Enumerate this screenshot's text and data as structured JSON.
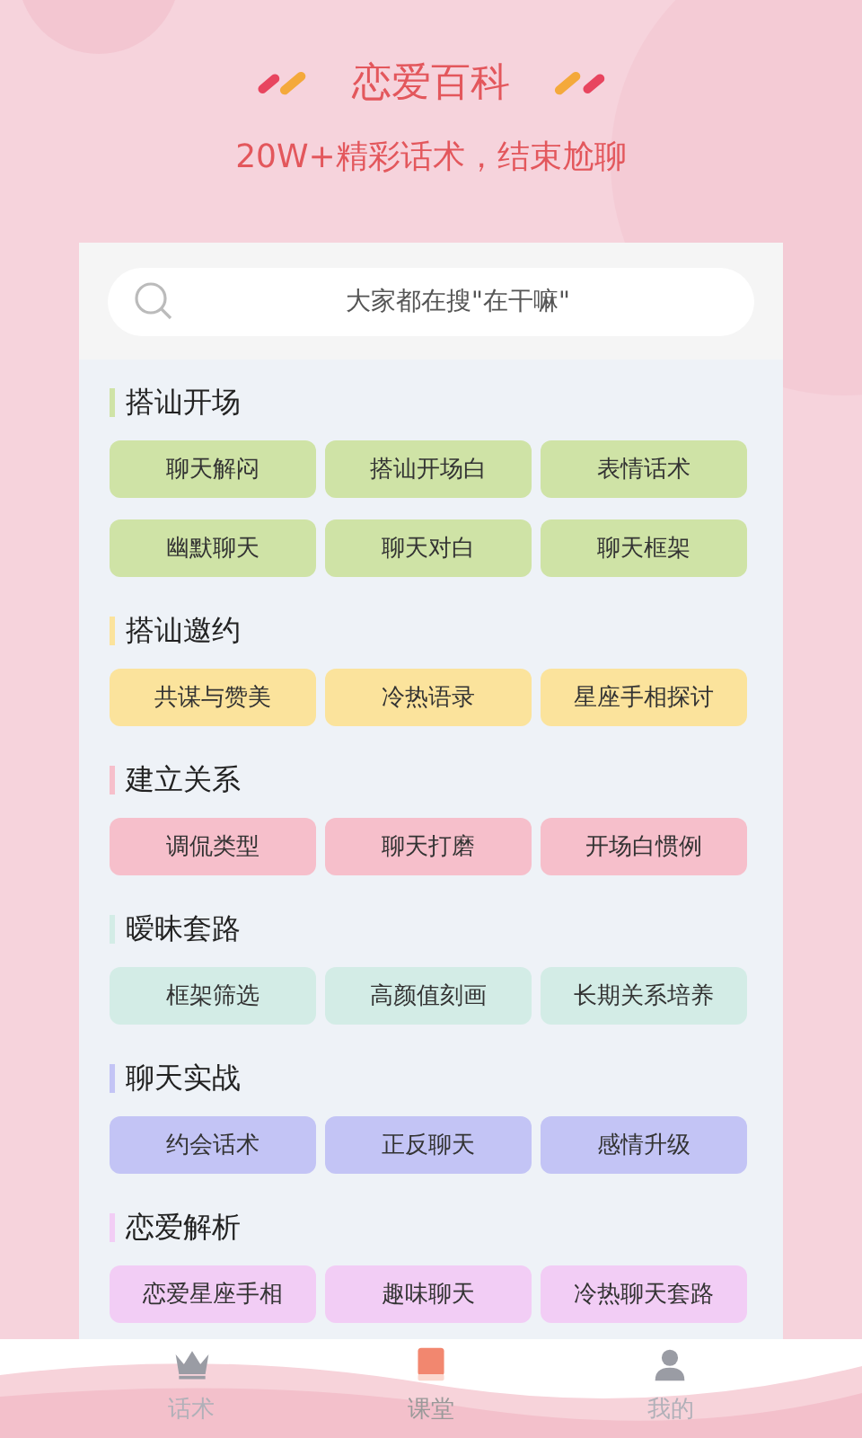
{
  "header": {
    "title": "恋爱百科",
    "subtitle": "20W+精彩话术，结束尬聊"
  },
  "search": {
    "placeholder": "大家都在搜\"在干嘛\""
  },
  "sections": [
    {
      "title": "搭讪开场",
      "color": "#cfe3a6",
      "items": [
        "聊天解闷",
        "搭讪开场白",
        "表情话术",
        "幽默聊天",
        "聊天对白",
        "聊天框架"
      ]
    },
    {
      "title": "搭讪邀约",
      "color": "#fbe39c",
      "items": [
        "共谋与赞美",
        "冷热语录",
        "星座手相探讨"
      ]
    },
    {
      "title": "建立关系",
      "color": "#f6bfcb",
      "items": [
        "调侃类型",
        "聊天打磨",
        "开场白惯例"
      ]
    },
    {
      "title": "暧昧套路",
      "color": "#d3ece6",
      "items": [
        "框架筛选",
        "高颜值刻画",
        "长期关系培养"
      ]
    },
    {
      "title": "聊天实战",
      "color": "#c3c4f5",
      "items": [
        "约会话术",
        "正反聊天",
        "感情升级"
      ]
    },
    {
      "title": "恋爱解析",
      "color": "#f2cdf5",
      "items": [
        "恋爱星座手相",
        "趣味聊天",
        "冷热聊天套路"
      ]
    }
  ],
  "tabs": [
    {
      "label": "话术",
      "kind": "crown",
      "selected": false
    },
    {
      "label": "课堂",
      "kind": "book",
      "selected": true
    },
    {
      "label": "我的",
      "kind": "person",
      "selected": false
    }
  ]
}
